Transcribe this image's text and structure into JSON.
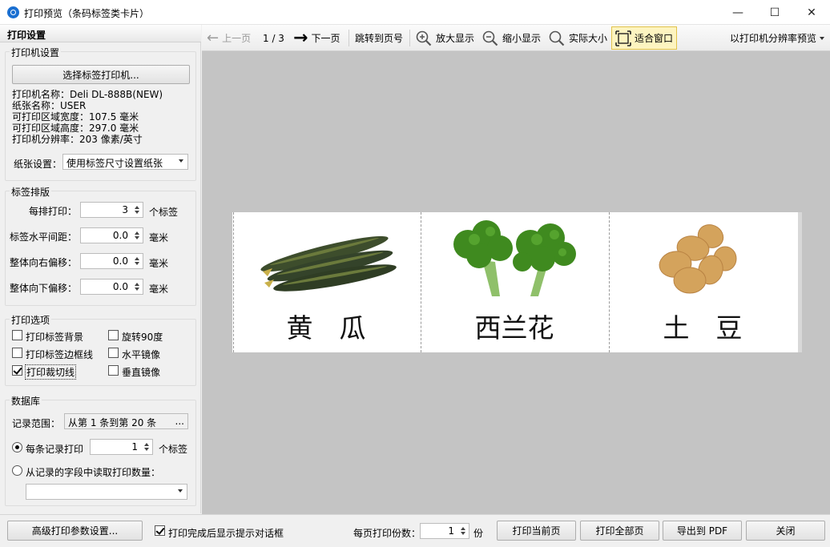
{
  "window": {
    "title": "打印预览（条码标签类卡片）",
    "minimize": "—",
    "maximize": "☐",
    "close": "✕"
  },
  "left_panel": {
    "header": "打印设置",
    "printer_group": {
      "title": "打印机设置",
      "select_button": "选择标签打印机...",
      "printer_name": "打印机名称：Deli DL-888B(NEW)",
      "paper_name": "纸张名称：USER",
      "print_width": "可打印区域宽度：107.5 毫米",
      "print_height": "可打印区域高度：297.0 毫米",
      "resolution": "打印机分辨率：203 像素/英寸",
      "paper_label": "纸张设置：",
      "paper_value": "使用标签尺寸设置纸张"
    },
    "layout_group": {
      "title": "标签排版",
      "per_row_label": "每排打印：",
      "per_row_value": "3",
      "per_row_unit": "个标签",
      "h_gap_label": "标签水平间距：",
      "h_gap_value": "0.0",
      "h_gap_unit": "毫米",
      "right_offset_label": "整体向右偏移：",
      "right_offset_value": "0.0",
      "right_offset_unit": "毫米",
      "down_offset_label": "整体向下偏移：",
      "down_offset_value": "0.0",
      "down_offset_unit": "毫米"
    },
    "options_group": {
      "title": "打印选项",
      "print_bg": "打印标签背景",
      "print_border": "打印标签边框线",
      "print_cutline": "打印裁切线",
      "rotate90": "旋转90度",
      "mirror_h": "水平镜像",
      "mirror_v": "垂直镜像",
      "print_bg_checked": false,
      "print_border_checked": false,
      "print_cutline_checked": true,
      "rotate90_checked": false,
      "mirror_h_checked": false,
      "mirror_v_checked": false
    },
    "db_group": {
      "title": "数据库",
      "range_label": "记录范围：",
      "range_value": "从第 1 条到第 20 条",
      "range_button": "...",
      "per_record_label": "每条记录打印",
      "per_record_value": "1",
      "per_record_unit": "个标签",
      "from_field_label": "从记录的字段中读取打印数量：",
      "field_value": ""
    }
  },
  "toolbar": {
    "prev": "上一页",
    "page_indicator": "1 / 3",
    "next": "下一页",
    "goto": "跳转到页号",
    "zoom_in": "放大显示",
    "zoom_out": "缩小显示",
    "actual_size": "实际大小",
    "fit_window": "适合窗口",
    "preview_mode": "以打印机分辨率预览"
  },
  "preview": {
    "cards": [
      {
        "label": "黄　瓜",
        "image": "cucumber-image"
      },
      {
        "label": "西兰花",
        "image": "broccoli-image"
      },
      {
        "label": "土　豆",
        "image": "potato-image"
      }
    ]
  },
  "bottom": {
    "advanced_button": "高级打印参数设置...",
    "show_prompt_label": "打印完成后显示提示对话框",
    "show_prompt_checked": true,
    "copies_label": "每页打印份数：",
    "copies_value": "1",
    "copies_unit": "份",
    "print_current": "打印当前页",
    "print_all": "打印全部页",
    "export_pdf": "导出到 PDF",
    "close": "关闭"
  }
}
